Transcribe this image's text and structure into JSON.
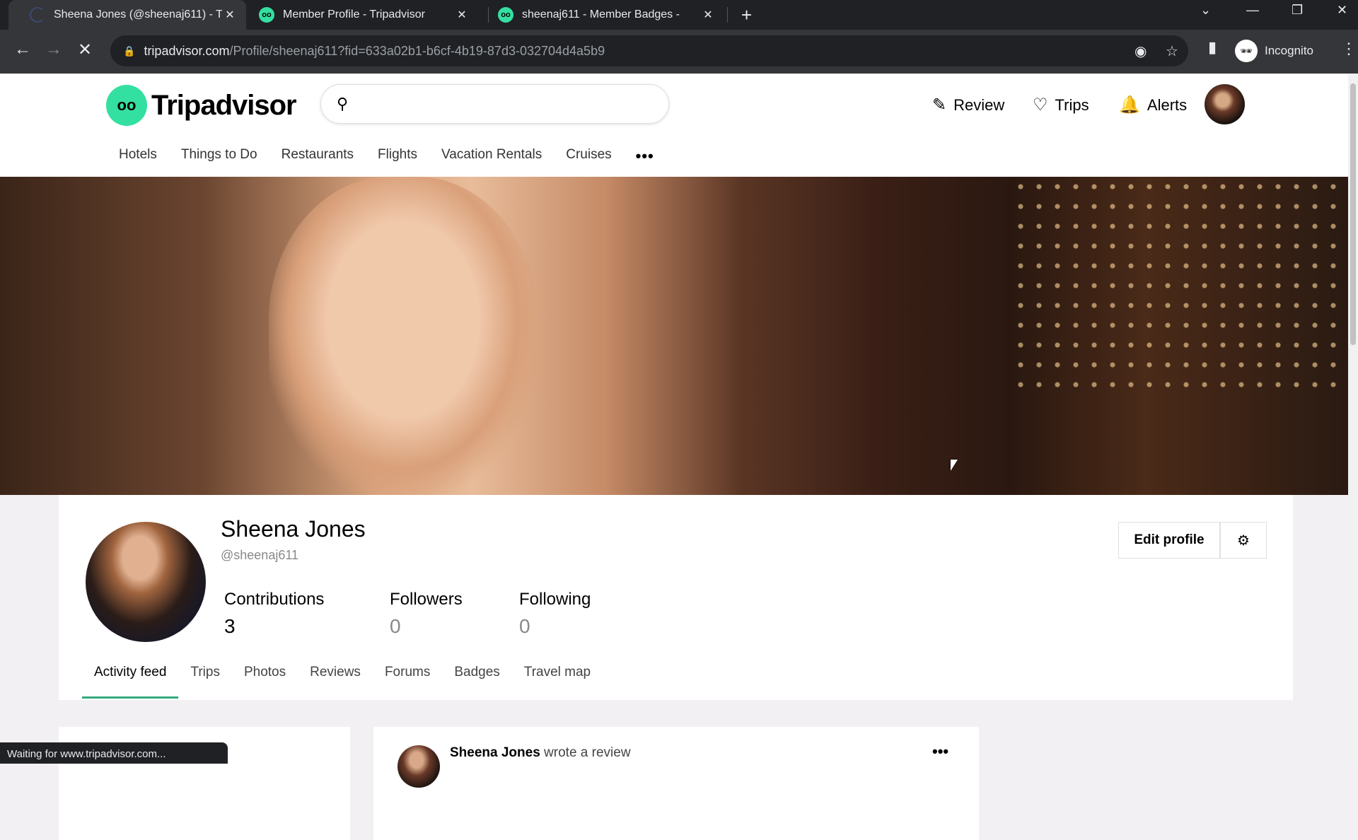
{
  "browser": {
    "tabs": [
      {
        "title": "Sheena Jones (@sheenaj611) - T",
        "active": true,
        "loading": true
      },
      {
        "title": "Member Profile - Tripadvisor",
        "active": false
      },
      {
        "title": "sheenaj611 - Member Badges -",
        "active": false
      }
    ],
    "new_tab": "+",
    "window_controls": {
      "dropdown": "⌄",
      "minimize": "—",
      "restore": "❐",
      "close": "✕"
    },
    "nav": {
      "back": "←",
      "forward": "→",
      "stop": "✕"
    },
    "url_domain": "tripadvisor.com",
    "url_path": "/Profile/sheenaj611?fid=633a02b1-b6cf-4b19-87d3-032704d4a5b9",
    "incognito_label": "Incognito",
    "status_text": "Waiting for www.tripadvisor.com..."
  },
  "header": {
    "logo_text": "Tripadvisor",
    "search_placeholder": "",
    "actions": [
      {
        "label": "Review",
        "icon": "✎"
      },
      {
        "label": "Trips",
        "icon": "♡"
      },
      {
        "label": "Alerts",
        "icon": "🔔"
      }
    ],
    "nav_items": [
      "Hotels",
      "Things to Do",
      "Restaurants",
      "Flights",
      "Vacation Rentals",
      "Cruises"
    ],
    "nav_more": "•••"
  },
  "profile": {
    "name": "Sheena Jones",
    "handle": "@sheenaj611",
    "stats": [
      {
        "label": "Contributions",
        "value": "3"
      },
      {
        "label": "Followers",
        "value": "0"
      },
      {
        "label": "Following",
        "value": "0"
      }
    ],
    "edit_label": "Edit profile",
    "settings_icon": "⚙",
    "tabs": [
      "Activity feed",
      "Trips",
      "Photos",
      "Reviews",
      "Forums",
      "Badges",
      "Travel map"
    ],
    "active_tab": "Activity feed"
  },
  "feed": {
    "author": "Sheena Jones",
    "action": " wrote a review",
    "more": "•••"
  },
  "colors": {
    "brand": "#34e0a1",
    "tab_underline": "#34a87c"
  }
}
